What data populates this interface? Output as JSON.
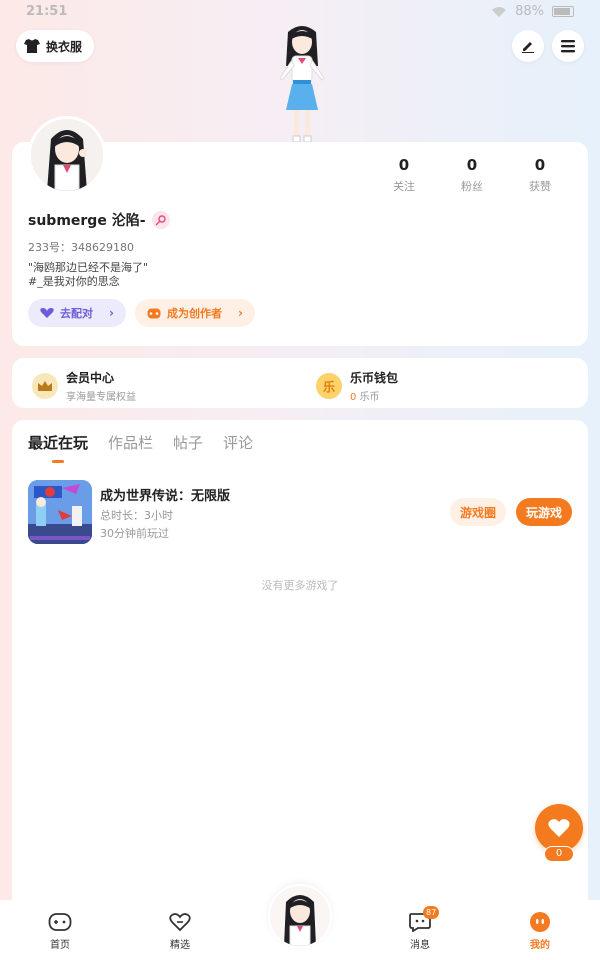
{
  "status_bar": {
    "time": "21:51",
    "battery": "88%"
  },
  "header": {
    "outfit_label": "换衣服"
  },
  "profile": {
    "stats": [
      {
        "value": "0",
        "label": "关注"
      },
      {
        "value": "0",
        "label": "粉丝"
      },
      {
        "value": "0",
        "label": "获赞"
      }
    ],
    "username": "submerge 沦陷-",
    "uid": "233号：348629180",
    "bio_line1": "\"海鸥那边已经不是海了\"",
    "bio_line2": "#_是我对你的思念",
    "match_label": "去配对",
    "creator_label": "成为创作者"
  },
  "vip": {
    "member_title": "会员中心",
    "member_sub": "享海量专属权益",
    "wallet_title": "乐币钱包",
    "wallet_amount": "0",
    "wallet_unit": "乐币",
    "coin_glyph": "乐"
  },
  "tabs": [
    "最近在玩",
    "作品栏",
    "帖子",
    "评论"
  ],
  "game": {
    "title": "成为世界传说：无限版",
    "playtime": "总时长：3小时",
    "last_played": "30分钟前玩过",
    "circle_label": "游戏圈",
    "play_label": "玩游戏"
  },
  "no_more": "没有更多游戏了",
  "like_count": "0",
  "nav": {
    "home": "首页",
    "featured": "精选",
    "messages": "消息",
    "messages_badge": "87",
    "mine": "我的"
  },
  "colors": {
    "accent": "#f47a20",
    "purple": "#6f5bd9"
  }
}
